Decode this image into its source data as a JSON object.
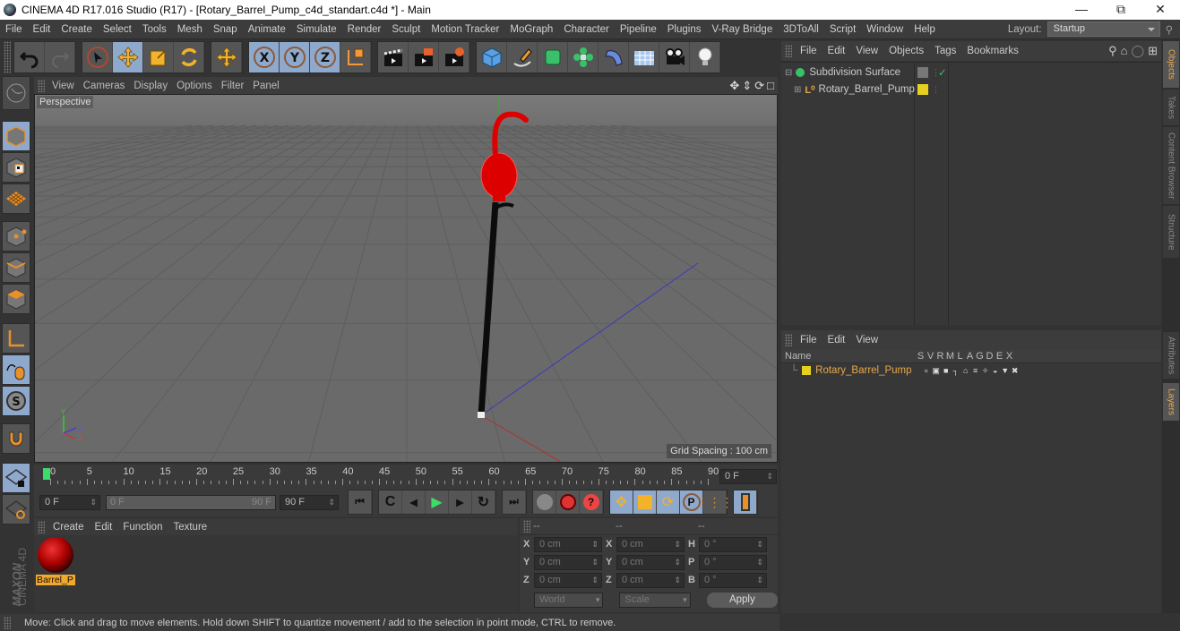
{
  "window": {
    "title": "CINEMA 4D R17.016 Studio (R17) - [Rotary_Barrel_Pump_c4d_standart.c4d *] - Main",
    "controls": [
      "minimize",
      "restore",
      "close"
    ]
  },
  "menubar": {
    "items": [
      "File",
      "Edit",
      "Create",
      "Select",
      "Tools",
      "Mesh",
      "Snap",
      "Animate",
      "Simulate",
      "Render",
      "Sculpt",
      "Motion Tracker",
      "MoGraph",
      "Character",
      "Pipeline",
      "Plugins",
      "V-Ray Bridge",
      "3DToAll",
      "Script",
      "Window",
      "Help"
    ],
    "layout_label": "Layout:",
    "layout_value": "Startup"
  },
  "toolbar": {
    "groups": [
      [
        "undo-icon",
        "redo-icon"
      ],
      [
        "live-selection-icon",
        "move-icon",
        "scale-icon",
        "rotate-icon"
      ],
      [
        "recent-tool-icon"
      ],
      [
        "x-axis-icon",
        "y-axis-icon",
        "z-axis-icon",
        "world-coordinate-icon"
      ],
      [
        "render-view-icon",
        "render-picture-viewer-icon",
        "render-settings-icon"
      ],
      [
        "cube-icon",
        "pen-spline-icon",
        "subdivision-icon",
        "cloner-icon",
        "bend-deformer-icon",
        "floor-icon",
        "camera-icon",
        "light-icon"
      ]
    ]
  },
  "left_tools": [
    "make-editable-icon",
    "model-mode-icon",
    "texture-mode-icon",
    "workplane-icon",
    "points-mode-icon",
    "edges-mode-icon",
    "polygons-mode-icon",
    "axis-mode-icon",
    "tweak-mode-icon",
    "solo-icon",
    "snap-icon",
    "lock-workplane-icon",
    "workplane-mode-icon"
  ],
  "viewport": {
    "menu": [
      "View",
      "Cameras",
      "Display",
      "Options",
      "Filter",
      "Panel"
    ],
    "label": "Perspective",
    "grid_spacing": "Grid Spacing : 100 cm",
    "axis_labels": {
      "y": "Y",
      "z": "Z",
      "x": "X"
    }
  },
  "timeline": {
    "ticks": [
      "0",
      "5",
      "10",
      "15",
      "20",
      "25",
      "30",
      "35",
      "40",
      "45",
      "50",
      "55",
      "60",
      "65",
      "70",
      "75",
      "80",
      "85",
      "90"
    ],
    "current_frame": "0 F"
  },
  "playback": {
    "start_field": "0 F",
    "range_start": "0 F",
    "range_end": "90 F",
    "end_field": "90 F"
  },
  "material_manager": {
    "menu": [
      "Create",
      "Edit",
      "Function",
      "Texture"
    ],
    "materials": [
      {
        "name": "Barrel_P"
      }
    ]
  },
  "coordinates": {
    "headers": [
      "--",
      "--",
      "--"
    ],
    "rows": [
      {
        "l1": "X",
        "v1": "0 cm",
        "l2": "X",
        "v2": "0 cm",
        "l3": "H",
        "v3": "0 °"
      },
      {
        "l1": "Y",
        "v1": "0 cm",
        "l2": "Y",
        "v2": "0 cm",
        "l3": "P",
        "v3": "0 °"
      },
      {
        "l1": "Z",
        "v1": "0 cm",
        "l2": "Z",
        "v2": "0 cm",
        "l3": "B",
        "v3": "0 °"
      }
    ],
    "mode": "World",
    "transform": "Scale",
    "apply": "Apply"
  },
  "status": "Move: Click and drag to move elements. Hold down SHIFT to quantize movement / add to the selection in point mode, CTRL to remove.",
  "object_manager": {
    "menu": [
      "File",
      "Edit",
      "View",
      "Objects",
      "Tags",
      "Bookmarks"
    ],
    "objects": [
      {
        "name": "Subdivision Surface",
        "color": "#c8c8c8"
      },
      {
        "name": "Rotary_Barrel_Pump",
        "color": "#c8c8c8"
      }
    ]
  },
  "layer_manager": {
    "menu": [
      "File",
      "Edit",
      "View"
    ],
    "columns": [
      "Name",
      "S",
      "V",
      "R",
      "M",
      "L",
      "A",
      "G",
      "D",
      "E",
      "X"
    ],
    "layers": [
      {
        "name": "Rotary_Barrel_Pump",
        "color": "#e6d21e"
      }
    ]
  },
  "right_tabs": {
    "top": [
      "Objects",
      "Takes",
      "Content Browser",
      "Structure"
    ],
    "bottom": [
      "Attributes",
      "Layers"
    ]
  },
  "brand": {
    "maxon": "MAXON",
    "cinema": "CINEMA 4D"
  },
  "colors": {
    "accent": "#e8a84a",
    "selected_blue": "#8fa9cc",
    "layer_yellow": "#e6d21e"
  }
}
